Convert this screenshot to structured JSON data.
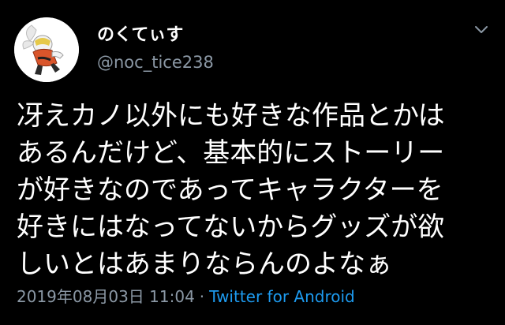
{
  "user": {
    "display_name": "のくてぃす",
    "handle": "@noc_tice238",
    "avatar_icon": "raboot-character-avatar"
  },
  "tweet": {
    "lines": [
      "冴えカノ以外にも好きな作品とかは",
      "あるんだけど、基本的にストーリー",
      "が好きなのであってキャラクターを",
      "好きにはなってないからグッズが欲",
      "しいとはあまりならんのよなぁ"
    ]
  },
  "meta": {
    "timestamp": "2019年08月03日 11:04",
    "separator": "·",
    "source": "Twitter for Android"
  },
  "icons": {
    "more": "chevron-down-icon"
  },
  "colors": {
    "background": "#000000",
    "text": "#ffffff",
    "muted": "#8b98a5",
    "link": "#1d9bf0"
  }
}
